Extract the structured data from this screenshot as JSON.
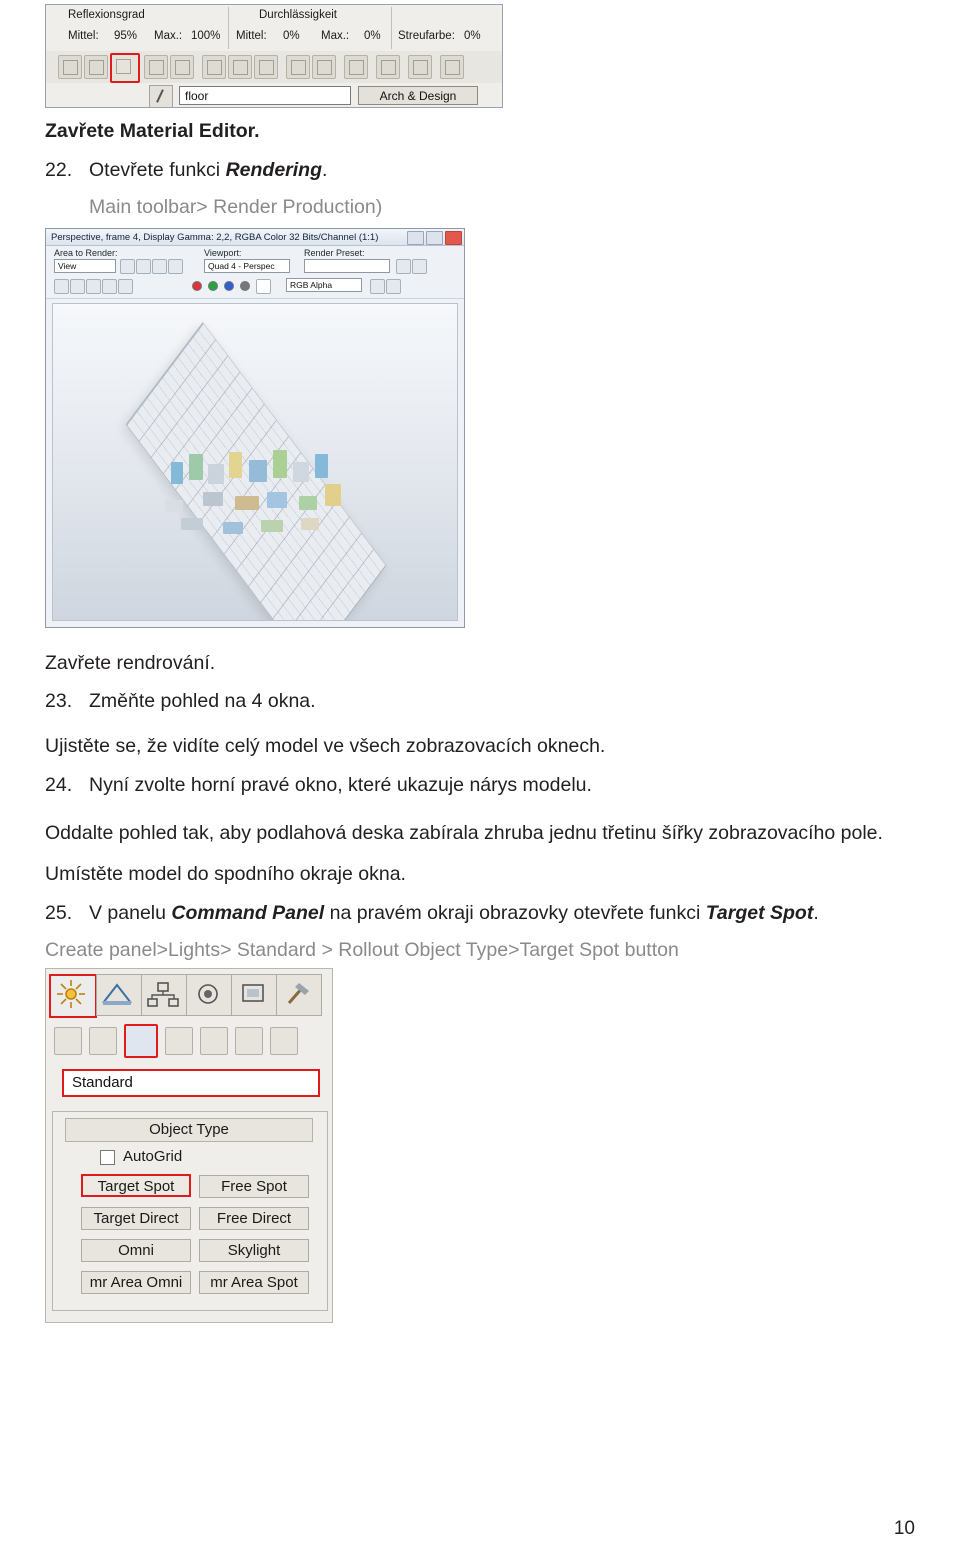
{
  "document": {
    "page_number": "10"
  },
  "material_editor_figure": {
    "name": "material-editor-screenshot",
    "labels": {
      "reflexionsgrad": "Reflexionsgrad",
      "durchlaessigkeit": "Durchlässigkeit",
      "mittel1": "Mittel:",
      "mittel1_value": "95%",
      "max1": "Max.:",
      "max1_value": "100%",
      "mittel2": "Mittel:",
      "mittel2_value": "0%",
      "max2": "Max.:",
      "max2_value": "0%",
      "streufarbe": "Streufarbe:",
      "streufarbe_value": "0%"
    },
    "material_name": "floor",
    "shader_name": "Arch & Design"
  },
  "body": {
    "close_material_editor": "Zavřete Material Editor.",
    "steps": [
      {
        "num": "22.",
        "text_prefix": "Otevřete funkci ",
        "text_bold": "Rendering",
        "text_suffix": ".",
        "hint": "Main toolbar> Render Production)"
      },
      {
        "num": "23.",
        "text": "Změňte pohled na 4 okna.",
        "sub": "Ujistěte se, že vidíte celý model ve všech zobrazovacích oknech."
      },
      {
        "num": "24.",
        "text": "Nyní zvolte horní pravé okno, které ukazuje nárys modelu.",
        "sub1": "Oddalte pohled tak, aby podlahová deska zabírala zhruba jednu třetinu šířky zobrazovacího pole.",
        "sub2": "Umístěte model do spodního okraje okna."
      },
      {
        "num": "25.",
        "text_prefix": "V panelu ",
        "text_bold1": "Command Panel",
        "text_mid": " na pravém okraji obrazovky otevřete funkci ",
        "text_bold2": "Target Spot",
        "text_suffix": ".",
        "hint": "Create panel>Lights> Standard > Rollout Object Type>Target Spot button"
      }
    ],
    "close_rendering": "Zavřete rendrování."
  },
  "render_figure": {
    "name": "render-window-screenshot",
    "title": "Perspective, frame 4, Display Gamma: 2,2, RGBA Color 32 Bits/Channel (1:1)",
    "area_to_render_label": "Area to Render:",
    "area_to_render_value": "View",
    "viewport_label": "Viewport:",
    "viewport_value": "Quad 4 - Perspec",
    "render_preset_label": "Render Preset:",
    "render_preset_value": "",
    "channel_value": "RGB Alpha"
  },
  "command_panel_figure": {
    "name": "command-panel-screenshot",
    "standard_dropdown": "Standard",
    "object_type_rollout": "Object Type",
    "autogrid_label": "AutoGrid",
    "buttons": [
      "Target Spot",
      "Free Spot",
      "Target Direct",
      "Free Direct",
      "Omni",
      "Skylight",
      "mr Area Omni",
      "mr Area Spot"
    ]
  }
}
